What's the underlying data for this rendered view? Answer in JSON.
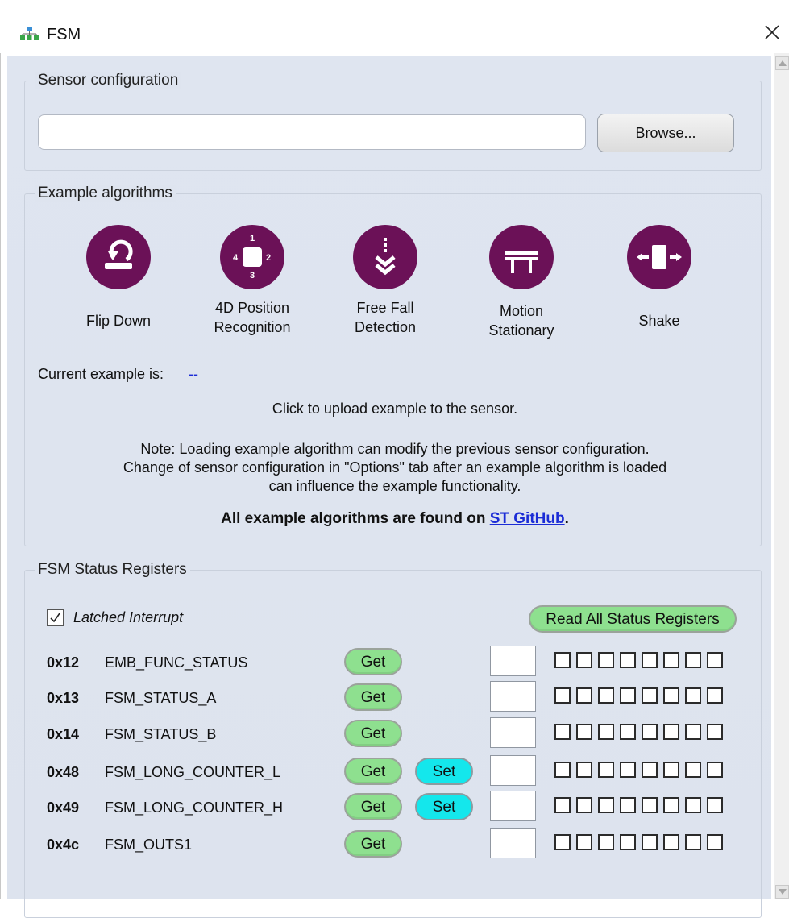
{
  "window": {
    "title": "FSM"
  },
  "sensor_config": {
    "legend": "Sensor configuration",
    "path_value": "",
    "browse_label": "Browse..."
  },
  "examples": {
    "legend": "Example algorithms",
    "items": [
      {
        "icon": "flip-down-icon",
        "label_line1": "Flip Down",
        "label_line2": ""
      },
      {
        "icon": "4d-position-icon",
        "label_line1": "4D Position",
        "label_line2": "Recognition"
      },
      {
        "icon": "free-fall-icon",
        "label_line1": "Free Fall",
        "label_line2": "Detection"
      },
      {
        "icon": "motion-stationary-icon",
        "label_line1": "Motion",
        "label_line2": "Stationary"
      },
      {
        "icon": "shake-icon",
        "label_line1": "Shake",
        "label_line2": ""
      }
    ],
    "icon_digits": {
      "top": "1",
      "right": "2",
      "bottom": "3",
      "left": "4"
    },
    "current_label": "Current example is:",
    "current_value": "--",
    "click_hint": "Click to upload example to the sensor.",
    "note_line1": "Note: Loading example algorithm can modify the previous sensor configuration.",
    "note_line2": "Change of sensor configuration in \"Options\" tab after an example algorithm is loaded",
    "note_line3": "can influence the example functionality.",
    "github_prefix": "All example algorithms are found on ",
    "github_link": "ST GitHub",
    "github_suffix": "."
  },
  "status_registers": {
    "legend": "FSM Status Registers",
    "latched_label": "Latched Interrupt",
    "latched_checked": true,
    "read_all_label": "Read All Status Registers",
    "get_label": "Get",
    "set_label": "Set",
    "rows": [
      {
        "addr": "0x12",
        "name": "EMB_FUNC_STATUS",
        "has_set": false,
        "value": ""
      },
      {
        "addr": "0x13",
        "name": "FSM_STATUS_A",
        "has_set": false,
        "value": ""
      },
      {
        "addr": "0x14",
        "name": "FSM_STATUS_B",
        "has_set": false,
        "value": ""
      },
      {
        "addr": "0x48",
        "name": "FSM_LONG_COUNTER_L",
        "has_set": true,
        "value": ""
      },
      {
        "addr": "0x49",
        "name": "FSM_LONG_COUNTER_H",
        "has_set": true,
        "value": ""
      },
      {
        "addr": "0x4c",
        "name": "FSM_OUTS1",
        "has_set": false,
        "value": ""
      }
    ]
  },
  "colors": {
    "accent_purple": "#6b1157",
    "get_green": "#8ee08f",
    "set_cyan": "#14e7ec",
    "link_blue": "#1b2cd6",
    "panel_bg": "#dee4ef"
  }
}
